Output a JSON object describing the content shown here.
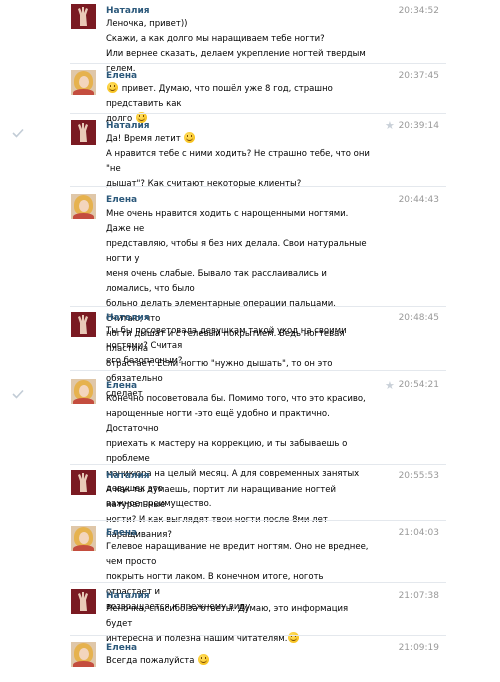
{
  "messages": [
    {
      "author": "Наталия",
      "time": "20:34:52",
      "lines": [
        "Леночка, привет))",
        "Скажи, а как долго мы наращиваем тебе ногти?",
        "Или вернее сказать, делаем укрепление ногтей твердым гелем."
      ]
    },
    {
      "author": "Елена",
      "time": "20:37:45",
      "lines": [
        "привет. Думаю, что пошёл уже 8 год, страшно представить как",
        "долго"
      ]
    },
    {
      "author": "Наталия",
      "time": "20:39:14",
      "lines": [
        "Да! Время летит",
        "А нравится тебе с ними ходить? Не страшно тебе, что они \"не",
        "дышат\"? Как считают некоторые клиенты?"
      ]
    },
    {
      "author": "Елена",
      "time": "20:44:43",
      "lines": [
        "Мне очень нравится ходить с нарощенными ногтями. Даже не",
        "представляю, чтобы я без них делала. Свои натуральные ногти у",
        "меня очень слабые. Бывало так расслаивались и ломались, что было",
        "больно делать элементарные операции пальцами. Считаю, что",
        "ногти дышат и с гелевый покрытием. Ведь ногтевая пластина",
        "отрастает. Если ногтю \"нужно дышать\", то он это обязательно",
        "сделает"
      ]
    },
    {
      "author": "Наталия",
      "time": "20:48:45",
      "lines": [
        "Ты бы посоветовала девушкам такой уход на своими ногтями? Считая",
        "его безопасным?"
      ]
    },
    {
      "author": "Елена",
      "time": "20:54:21",
      "lines": [
        "Конечно посоветовала бы. Помимо того, что это красиво,",
        "нарощенные ногти -это ещё удобно и практично. Достаточно",
        "приехать к мастеру на коррекцию, и ты забываешь о проблеме",
        "маникюра на целый месяц. А для современных занятых девушек это",
        "важное преимущество."
      ]
    },
    {
      "author": "Наталия",
      "time": "20:55:53",
      "lines": [
        "А как ты думаешь, портит ли наращивание ногтей натуральные",
        "ногти? И как выглядят твои ногти после 8ми лет наращивания?"
      ]
    },
    {
      "author": "Елена",
      "time": "21:04:03",
      "lines": [
        "Гелевое наращивание не вредит ногтям. Оно не вреднее, чем просто",
        "покрыть ногти лаком. В конечном итоге, ноготь отрастает и",
        "возвращается к прежнему виду"
      ]
    },
    {
      "author": "Наталия",
      "time": "21:07:38",
      "lines": [
        "Леночка, спасибо за ответы. Думаю, это информация будет",
        "интересна и полезна нашим читателям."
      ]
    },
    {
      "author": "Елена",
      "time": "21:09:19",
      "lines": [
        "Всегда пожалуйста"
      ]
    }
  ],
  "colors": {
    "author_name": "#2b587a",
    "timestamp": "#999999",
    "divider": "#e4e8ed",
    "read_check": "#c2ccd6"
  },
  "icons": {
    "smile": "smile-emoji-icon",
    "check": "read-check-icon",
    "star": "star-icon"
  }
}
